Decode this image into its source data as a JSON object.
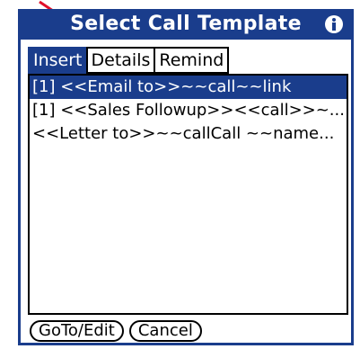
{
  "dialog": {
    "title": "Select Call Template"
  },
  "tabs": [
    {
      "label": "Insert",
      "active": true
    },
    {
      "label": "Details",
      "active": false
    },
    {
      "label": "Remind",
      "active": false
    }
  ],
  "templates": [
    {
      "label": "[1] <<Email to>>~~call~~link",
      "selected": true
    },
    {
      "label": "[1] <<Sales Followup>><<call>>~...",
      "selected": false
    },
    {
      "label": "<<Letter to>>~~callCall ~~name...",
      "selected": false
    }
  ],
  "buttons": {
    "goto_edit": "GoTo/Edit",
    "cancel": "Cancel"
  },
  "icons": {
    "info": "info-icon",
    "annotation": "red-arrow-icon"
  },
  "colors": {
    "accent": "#1a3d8c",
    "annotation": "#e0102a"
  }
}
